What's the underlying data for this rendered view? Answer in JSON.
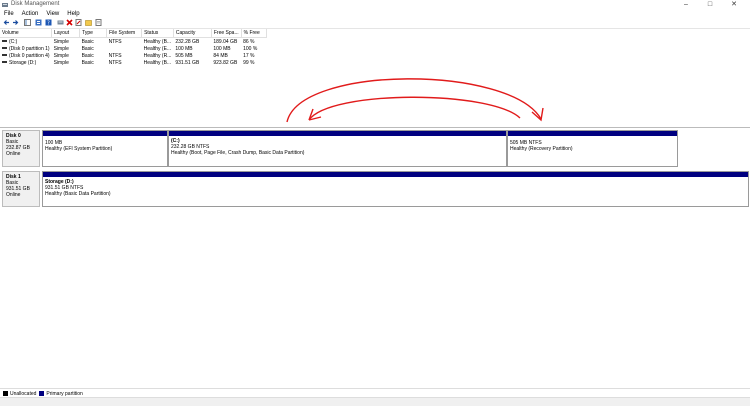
{
  "window": {
    "title": "Disk Management",
    "minimize_glyph": "–",
    "maximize_glyph": "□",
    "close_glyph": "✕"
  },
  "menu": [
    "File",
    "Action",
    "View",
    "Help"
  ],
  "toolbar": [
    "back-icon",
    "forward-icon",
    "properties-icon",
    "help-icon",
    "connect-icon",
    "delete-icon",
    "refresh-icon",
    "folder-icon",
    "page-icon"
  ],
  "volume_list": {
    "columns": [
      "Volume",
      "Layout",
      "Type",
      "File System",
      "Status",
      "Capacity",
      "Free Spa...",
      "% Free"
    ],
    "rows": [
      [
        "(C:)",
        "Simple",
        "Basic",
        "NTFS",
        "Healthy (B...",
        "232.28 GB",
        "189.04 GB",
        "86 %"
      ],
      [
        "(Disk 0 partition 1)",
        "Simple",
        "Basic",
        "",
        "Healthy (E...",
        "100 MB",
        "100 MB",
        "100 %"
      ],
      [
        "(Disk 0 partition 4)",
        "Simple",
        "Basic",
        "NTFS",
        "Healthy (R...",
        "505 MB",
        "84 MB",
        "17 %"
      ],
      [
        "Storage (D:)",
        "Simple",
        "Basic",
        "NTFS",
        "Healthy (B...",
        "931.51 GB",
        "923.82 GB",
        "99 %"
      ]
    ]
  },
  "disks": [
    {
      "name": "Disk 0",
      "type": "Basic",
      "size": "232.87 GB",
      "status": "Online",
      "partitions": [
        {
          "name": "",
          "size": "100 MB",
          "status": "Healthy (EFI System Partition)"
        },
        {
          "name": "(C:)",
          "size": "232.28 GB NTFS",
          "status": "Healthy (Boot, Page File, Crash Dump, Basic Data Partition)"
        },
        {
          "name": "",
          "size": "505 MB NTFS",
          "status": "Healthy (Recovery Partition)"
        }
      ]
    },
    {
      "name": "Disk 1",
      "type": "Basic",
      "size": "931.51 GB",
      "status": "Online",
      "partitions": [
        {
          "name": "Storage (D:)",
          "size": "931.51 GB NTFS",
          "status": "Healthy (Basic Data Partition)"
        }
      ]
    }
  ],
  "legend": [
    {
      "label": "Unallocated",
      "color": "#000000"
    },
    {
      "label": "Primary partition",
      "color": "#000080"
    }
  ],
  "colors": {
    "partition_bar": "#000080",
    "annotation": "#e11b1b"
  }
}
